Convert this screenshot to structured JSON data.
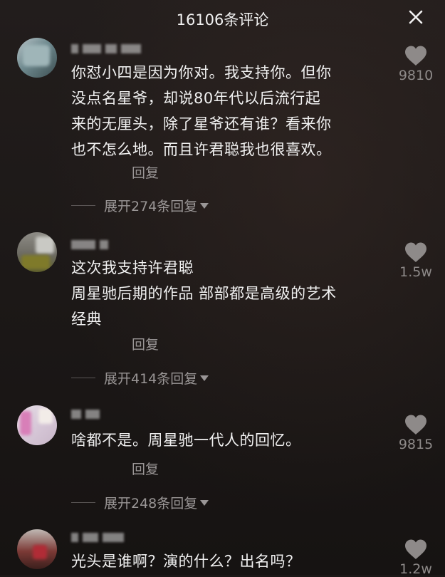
{
  "header": {
    "title": "16106条评论"
  },
  "comments": [
    {
      "text_lines": [
        "你怼小四是因为你对。我支持你。但你",
        "没点名星爷，却说80年代以后流行起",
        "来的无厘头，除了星爷还有谁？看来你",
        "也不怎么地。而且许君聪我也很喜欢。"
      ],
      "reply_label": "回复",
      "expand_label": "展开274条回复",
      "likes": "9810"
    },
    {
      "text_lines": [
        "这次我支持许君聪",
        "周星驰后期的作品 部部都是高级的艺术",
        "经典"
      ],
      "reply_label": "回复",
      "expand_label": "展开414条回复",
      "likes": "1.5w"
    },
    {
      "text_lines": [
        "啥都不是。周星驰一代人的回忆。"
      ],
      "reply_label": "回复",
      "expand_label": "展开248条回复",
      "likes": "9815"
    },
    {
      "text_lines": [
        "光头是谁啊？演的什么？出名吗？"
      ],
      "likes": "1.2w"
    }
  ],
  "icons": {
    "like": "heart-icon",
    "close": "close-icon",
    "expand": "triangle-down-icon"
  },
  "colors": {
    "background": "#1b1716",
    "muted_text": "#9a9696",
    "like_icon": "#8e8a89"
  }
}
